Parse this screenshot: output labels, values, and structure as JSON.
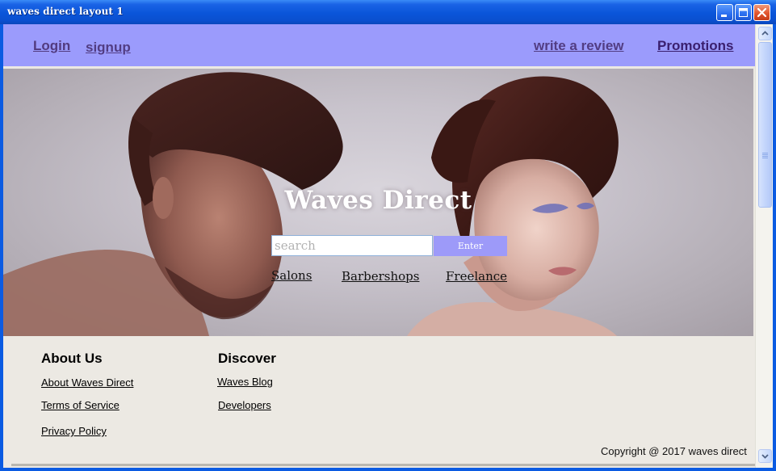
{
  "window": {
    "title": "waves direct layout 1"
  },
  "nav": {
    "login": "Login",
    "signup": "signup",
    "review": "write a review",
    "promotions": "Promotions"
  },
  "hero": {
    "title": "Waves Direct",
    "search_placeholder": "search",
    "enter_label": "Enter",
    "categories": [
      "Salons",
      "Barbershops",
      "Freelance"
    ]
  },
  "footer": {
    "about": {
      "heading": "About Us",
      "links": [
        "About Waves Direct",
        "Terms of Service",
        "Privacy Policy"
      ]
    },
    "discover": {
      "heading": "Discover",
      "links": [
        "Waves Blog",
        "Developers"
      ]
    },
    "copyright": "Copyright @ 2017 waves direct"
  },
  "colors": {
    "nav_bg": "#9b9bfc",
    "nav_link": "#523d83",
    "enter_button": "#9d9af9",
    "titlebar": "#0a55d9",
    "client_bg": "#ece9e3"
  },
  "icons": {
    "minimize": "minimize-icon",
    "maximize": "maximize-icon",
    "close": "close-icon",
    "scroll_up": "chevron-up-icon",
    "scroll_down": "chevron-down-icon"
  }
}
